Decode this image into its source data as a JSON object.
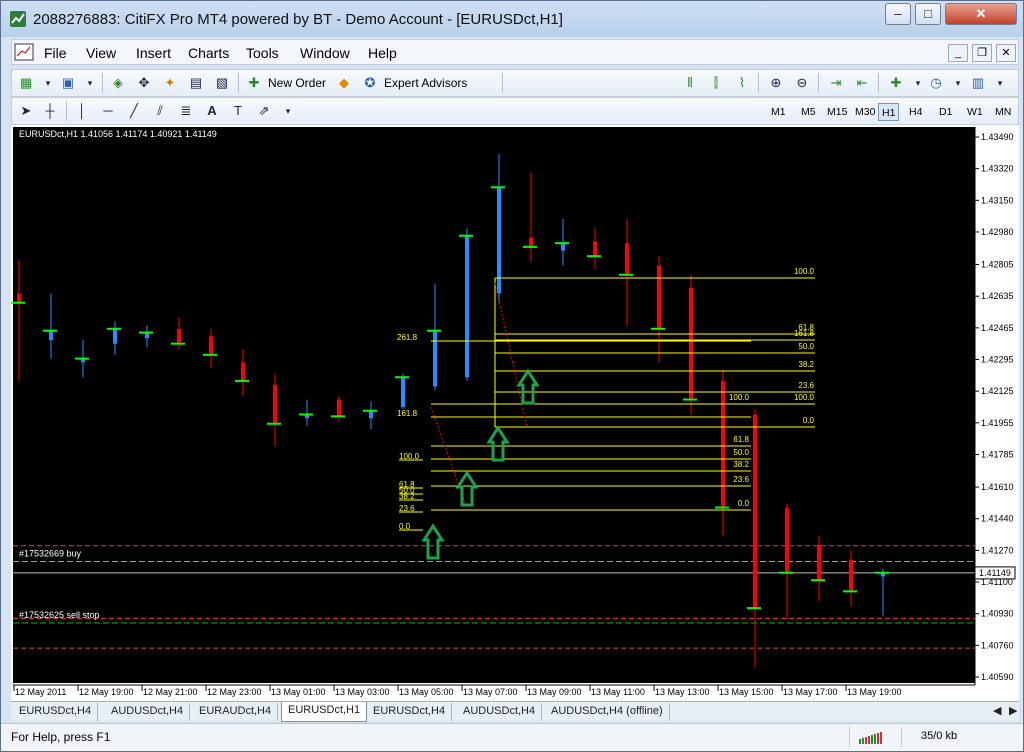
{
  "window": {
    "title": "2088276883: CitiFX Pro MT4 powered by BT - Demo Account - [EURUSDct,H1]",
    "min": "‒",
    "max": "□",
    "close": "✕"
  },
  "menu": [
    "File",
    "View",
    "Insert",
    "Charts",
    "Tools",
    "Window",
    "Help"
  ],
  "toolbar": {
    "new_order": "New Order",
    "expert_advisors": "Expert Advisors"
  },
  "timeframes": [
    "M1",
    "M5",
    "M15",
    "M30",
    "H1",
    "H4",
    "D1",
    "W1",
    "MN"
  ],
  "active_timeframe": "H1",
  "chart": {
    "header": "EURUSDct,H1  1.41056 1.41174 1.40921 1.41149",
    "price_labels": [
      "1.43490",
      "1.43320",
      "1.43150",
      "1.42980",
      "1.42805",
      "1.42635",
      "1.42465",
      "1.42295",
      "1.42125",
      "1.41955",
      "1.41785",
      "1.41610",
      "1.41440",
      "1.41270",
      "1.41100",
      "1.40930",
      "1.40760",
      "1.40590"
    ],
    "current_price": "1.41149",
    "time_labels": [
      "12 May 2011",
      "12 May 19:00",
      "12 May 21:00",
      "12 May 23:00",
      "13 May 01:00",
      "13 May 03:00",
      "13 May 05:00",
      "13 May 07:00",
      "13 May 09:00",
      "13 May 11:00",
      "13 May 13:00",
      "13 May 15:00",
      "13 May 17:00",
      "13 May 19:00"
    ],
    "order_labels": [
      "#17532669 buy",
      "#17532625 sell stop"
    ],
    "fib_sets": [
      {
        "labels": [
          "100.0",
          "61.8",
          "50.0",
          "38.2",
          "23.6",
          "0.0"
        ]
      },
      {
        "labels": [
          "261.8",
          "161.8",
          "100.0",
          "61.8",
          "50.0",
          "38.2",
          "23.6",
          "0.0"
        ]
      },
      {
        "labels": [
          "100.0",
          "61.8",
          "50.0",
          "38.2",
          "23.6",
          "0.0"
        ]
      },
      {
        "labels": [
          "161.8",
          "61.8",
          "50.0",
          "38.2",
          "23.6",
          "100.0",
          "0.0"
        ]
      }
    ],
    "colors": {
      "bg": "#000000",
      "bull": "#1e90ff",
      "bear": "#ff0000",
      "ma": "#00ff00",
      "fib": "#ffff00",
      "arrow": "#1fa34a",
      "order_buy": "#ff8c00",
      "order_red": "#ff3030",
      "order_green": "#00c000",
      "grid_text": "#ffffff"
    }
  },
  "tabs": [
    "EURUSDct,H4",
    "AUDUSDct,H4",
    "EURAUDct,H4",
    "EURUSDct,H1",
    "EURUSDct,H4",
    "AUDUSDct,H4",
    "AUDUSDct,H4 (offline)"
  ],
  "active_tab": "EURUSDct,H1",
  "status": {
    "help": "For Help, press F1",
    "traffic": "35/0 kb"
  }
}
